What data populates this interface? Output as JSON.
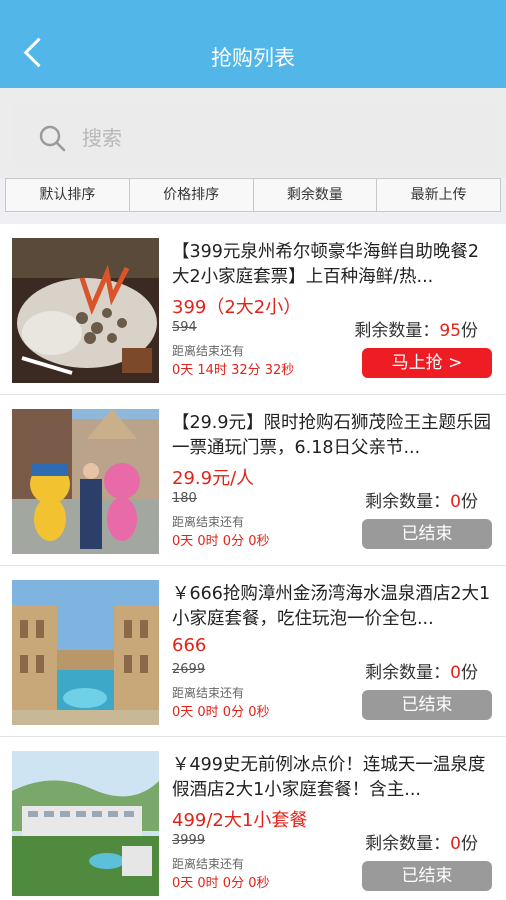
{
  "header": {
    "title": "抢购列表"
  },
  "search": {
    "placeholder": "搜索"
  },
  "sort_tabs": [
    "默认排序",
    "价格排序",
    "剩余数量",
    "最新上传"
  ],
  "remain_label": "剩余数量：",
  "remain_unit": "份",
  "ends_label": "距离结束还有",
  "items": [
    {
      "name": "【399元泉州希尔顿豪华海鲜自助晚餐2大2小家庭套票】上百种海鲜/热...",
      "price": "399（2大2小）",
      "old_price": "594",
      "remain": "95",
      "countdown": "0天 14时 32分 32秒",
      "button": "马上抢 >"
    },
    {
      "name": "【29.9元】限时抢购石狮茂险王主题乐园一票通玩门票，6.18日父亲节...",
      "price": "29.9元/人",
      "old_price": "180",
      "remain": "0",
      "countdown": "0天  0时  0分  0秒",
      "button": "已结束"
    },
    {
      "name": "￥666抢购漳州金汤湾海水温泉酒店2大1小家庭套餐，吃住玩泡一价全包...",
      "price": "666",
      "old_price": "2699",
      "remain": "0",
      "countdown": "0天  0时  0分  0秒",
      "button": "已结束"
    },
    {
      "name": "￥499史无前例冰点价！连城天一温泉度假酒店2大1小家庭套餐！含主...",
      "price": "499/2大1小套餐",
      "old_price": "3999",
      "remain": "0",
      "countdown": "0天  0时  0分  0秒",
      "button": "已结束"
    }
  ]
}
